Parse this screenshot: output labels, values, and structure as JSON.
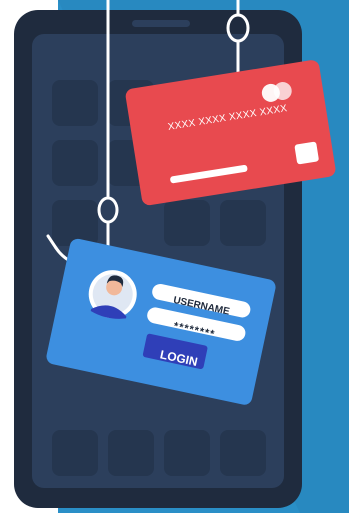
{
  "credit_card": {
    "number_mask": "XXXX XXXX XXXX XXXX"
  },
  "login_card": {
    "username_label": "USERNAME",
    "password_mask": "********",
    "login_label": "LOGIN"
  },
  "colors": {
    "background_panel": "#2a8fc7",
    "phone_body": "#1f2b3e",
    "phone_screen": "#2c3f5c",
    "credit_card": "#e84a4f",
    "login_card": "#3d8fe0",
    "login_button": "#2f3fb8"
  }
}
